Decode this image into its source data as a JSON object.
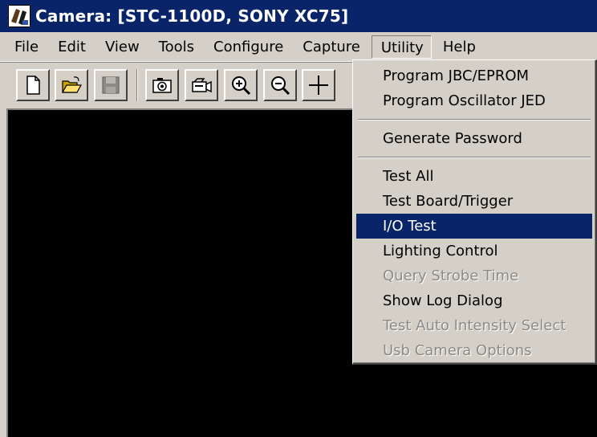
{
  "window": {
    "title": "Camera: [STC-1100D, SONY XC75]"
  },
  "menubar": {
    "items": [
      {
        "label": "File"
      },
      {
        "label": "Edit"
      },
      {
        "label": "View"
      },
      {
        "label": "Tools"
      },
      {
        "label": "Configure"
      },
      {
        "label": "Capture"
      },
      {
        "label": "Utility"
      },
      {
        "label": "Help"
      }
    ]
  },
  "toolbar": {
    "buttons": [
      {
        "icon": "new-document-icon"
      },
      {
        "icon": "open-folder-icon"
      },
      {
        "icon": "save-disk-icon"
      },
      {
        "icon": "camera-snapshot-icon"
      },
      {
        "icon": "video-camera-icon"
      },
      {
        "icon": "zoom-in-icon"
      },
      {
        "icon": "zoom-out-icon"
      },
      {
        "icon": "crosshair-icon"
      }
    ]
  },
  "utility_menu": {
    "groups": [
      [
        {
          "label": "Program JBC/EPROM",
          "enabled": true
        },
        {
          "label": "Program Oscillator JED",
          "enabled": true
        }
      ],
      [
        {
          "label": "Generate Password",
          "enabled": true
        }
      ],
      [
        {
          "label": "Test All",
          "enabled": true
        },
        {
          "label": "Test Board/Trigger",
          "enabled": true
        },
        {
          "label": "I/O Test",
          "enabled": true,
          "selected": true
        },
        {
          "label": "Lighting Control",
          "enabled": true
        },
        {
          "label": "Query Strobe Time",
          "enabled": false
        },
        {
          "label": "Show Log Dialog",
          "enabled": true
        },
        {
          "label": "Test Auto Intensity Select",
          "enabled": false
        },
        {
          "label": "Usb Camera Options",
          "enabled": false
        }
      ]
    ]
  },
  "colors": {
    "titlebar": "#0a246a",
    "face": "#d4d0c8",
    "highlight": "#0a246a",
    "disabled_text": "#8c8a84"
  }
}
